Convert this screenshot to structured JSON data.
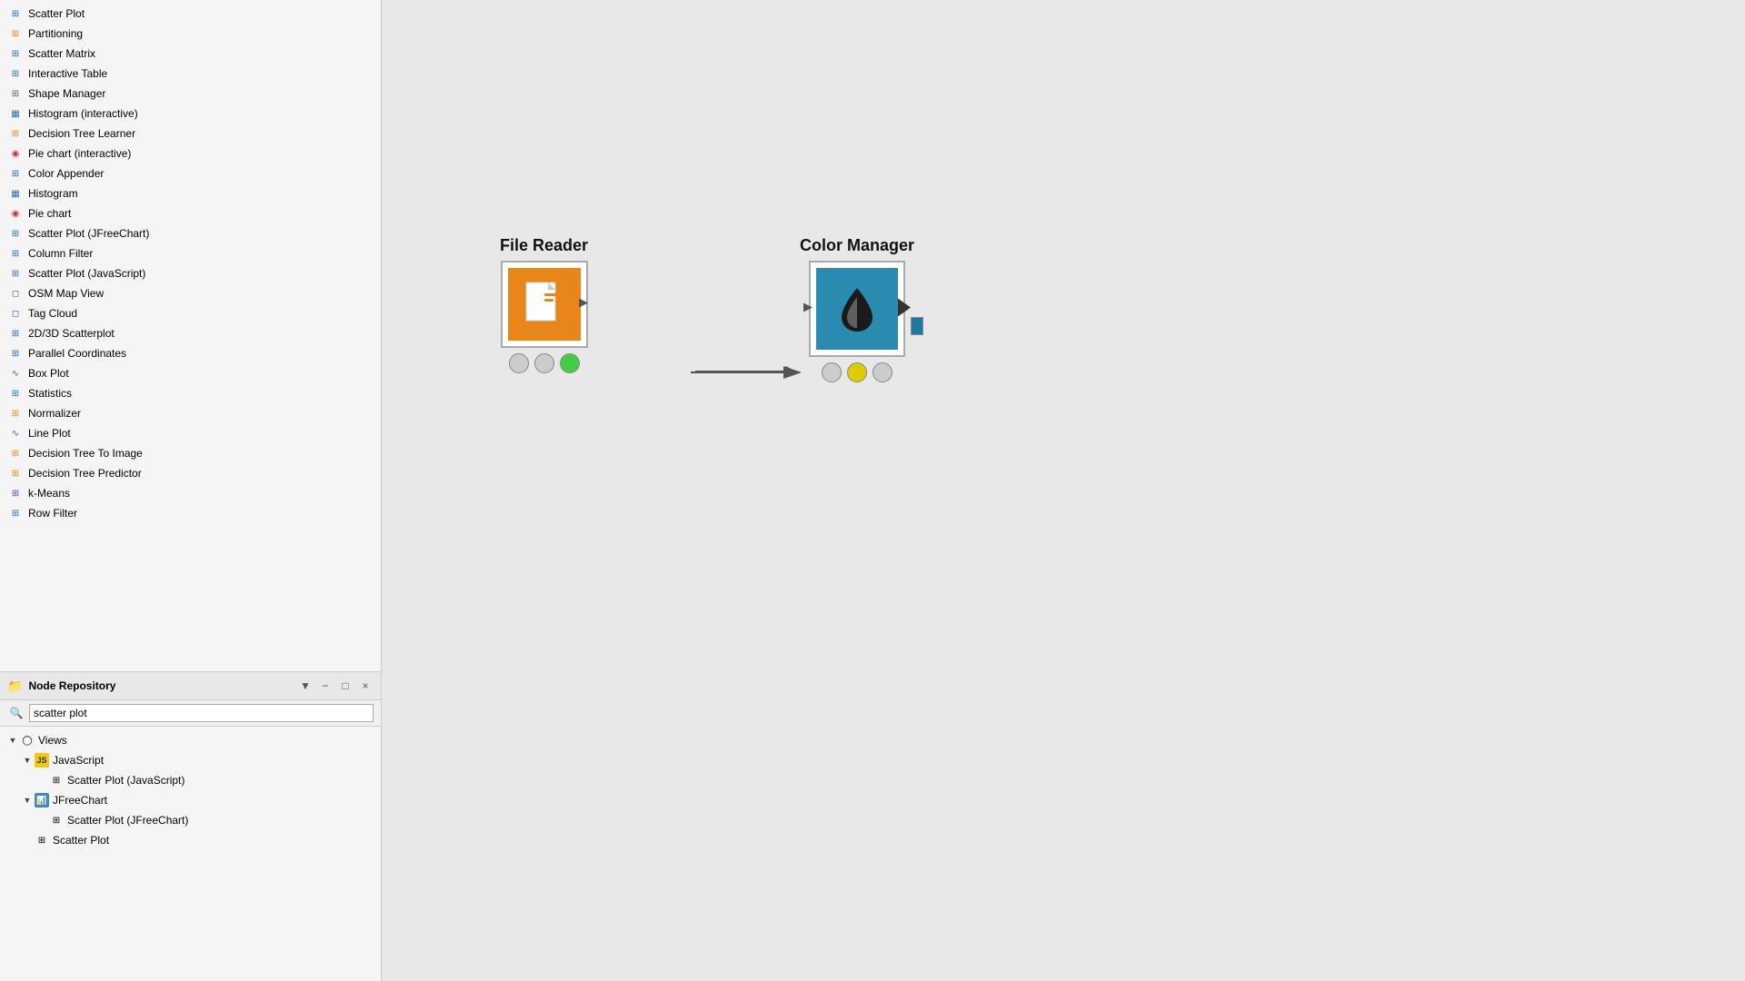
{
  "left_panel": {
    "node_list": [
      {
        "label": "Scatter Plot",
        "icon": "⊞",
        "icon_class": "icon-blue"
      },
      {
        "label": "Partitioning",
        "icon": "⊞",
        "icon_class": "icon-orange"
      },
      {
        "label": "Scatter Matrix",
        "icon": "⊞",
        "icon_class": "icon-blue"
      },
      {
        "label": "Interactive Table",
        "icon": "⊞",
        "icon_class": "icon-blue"
      },
      {
        "label": "Shape Manager",
        "icon": "⊞",
        "icon_class": "icon-gray"
      },
      {
        "label": "Histogram (interactive)",
        "icon": "▦",
        "icon_class": "icon-blue"
      },
      {
        "label": "Decision Tree Learner",
        "icon": "⊞",
        "icon_class": "icon-orange"
      },
      {
        "label": "Pie chart (interactive)",
        "icon": "◉",
        "icon_class": "icon-red"
      },
      {
        "label": "Color Appender",
        "icon": "⊞",
        "icon_class": "icon-blue"
      },
      {
        "label": "Histogram",
        "icon": "▦",
        "icon_class": "icon-blue"
      },
      {
        "label": "Pie chart",
        "icon": "◉",
        "icon_class": "icon-red"
      },
      {
        "label": "Scatter Plot (JFreeChart)",
        "icon": "⊞",
        "icon_class": "icon-blue"
      },
      {
        "label": "Column Filter",
        "icon": "⊞",
        "icon_class": "icon-blue"
      },
      {
        "label": "Scatter Plot (JavaScript)",
        "icon": "⊞",
        "icon_class": "icon-blue"
      },
      {
        "label": "OSM Map View",
        "icon": "◻",
        "icon_class": "icon-green"
      },
      {
        "label": "Tag Cloud",
        "icon": "◻",
        "icon_class": "icon-blue"
      },
      {
        "label": "2D/3D Scatterplot",
        "icon": "⊞",
        "icon_class": "icon-blue"
      },
      {
        "label": "Parallel Coordinates",
        "icon": "⊞",
        "icon_class": "icon-blue"
      },
      {
        "label": "Box Plot",
        "icon": "∿",
        "icon_class": "icon-blue"
      },
      {
        "label": "Statistics",
        "icon": "⊞",
        "icon_class": "icon-blue"
      },
      {
        "label": "Normalizer",
        "icon": "⊞",
        "icon_class": "icon-orange"
      },
      {
        "label": "Line Plot",
        "icon": "∿",
        "icon_class": "icon-blue"
      },
      {
        "label": "Decision Tree To Image",
        "icon": "⊞",
        "icon_class": "icon-orange"
      },
      {
        "label": "Decision Tree Predictor",
        "icon": "⊞",
        "icon_class": "icon-orange"
      },
      {
        "label": "k-Means",
        "icon": "⊞",
        "icon_class": "icon-purple"
      },
      {
        "label": "Row Filter",
        "icon": "⊞",
        "icon_class": "icon-blue"
      }
    ]
  },
  "bottom_section": {
    "repo_title": "Node Repository",
    "repo_icon": "🗂",
    "search_placeholder": "scatter plot",
    "search_value": "scatter plot",
    "tree": [
      {
        "label": "Views",
        "indent": 0,
        "expanded": true,
        "type": "category",
        "icon": "◯"
      },
      {
        "label": "JavaScript",
        "indent": 1,
        "expanded": true,
        "type": "group",
        "icon": "js"
      },
      {
        "label": "Scatter Plot (JavaScript)",
        "indent": 2,
        "expanded": false,
        "type": "leaf",
        "icon": "⊞"
      },
      {
        "label": "JFreeChart",
        "indent": 1,
        "expanded": true,
        "type": "group",
        "icon": "📊"
      },
      {
        "label": "Scatter Plot (JFreeChart)",
        "indent": 2,
        "expanded": false,
        "type": "leaf",
        "icon": "⊞"
      },
      {
        "label": "Scatter Plot",
        "indent": 1,
        "expanded": false,
        "type": "leaf",
        "icon": "⊞"
      }
    ]
  },
  "canvas": {
    "file_reader": {
      "title": "File Reader",
      "ports": [
        {
          "color": "gray"
        },
        {
          "color": "gray"
        },
        {
          "color": "green"
        }
      ]
    },
    "color_manager": {
      "title": "Color Manager",
      "ports": [
        {
          "color": "gray"
        },
        {
          "color": "yellow"
        },
        {
          "color": "gray"
        }
      ]
    }
  },
  "toolbar": {
    "filter_icon": "▼",
    "minimize_icon": "−",
    "maximize_icon": "□",
    "close_icon": "×"
  }
}
